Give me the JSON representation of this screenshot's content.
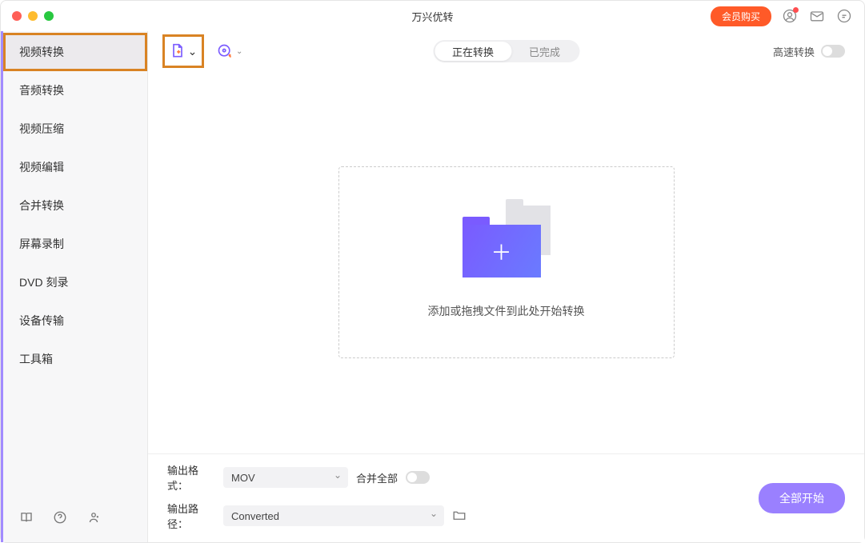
{
  "title": "万兴优转",
  "header": {
    "buy_label": "会员购买"
  },
  "sidebar": {
    "items": [
      {
        "label": "视频转换"
      },
      {
        "label": "音频转换"
      },
      {
        "label": "视频压缩"
      },
      {
        "label": "视频编辑"
      },
      {
        "label": "合并转换"
      },
      {
        "label": "屏幕录制"
      },
      {
        "label": "DVD 刻录"
      },
      {
        "label": "设备传输"
      },
      {
        "label": "工具箱"
      }
    ]
  },
  "toolbar": {
    "segments": {
      "converting": "正在转换",
      "done": "已完成"
    },
    "highspeed_label": "高速转换"
  },
  "dropzone": {
    "text": "添加或拖拽文件到此处开始转换"
  },
  "footer": {
    "format_label": "输出格式：",
    "format_value": "MOV",
    "merge_label": "合并全部",
    "path_label": "输出路径：",
    "path_value": "Converted",
    "start_label": "全部开始"
  }
}
